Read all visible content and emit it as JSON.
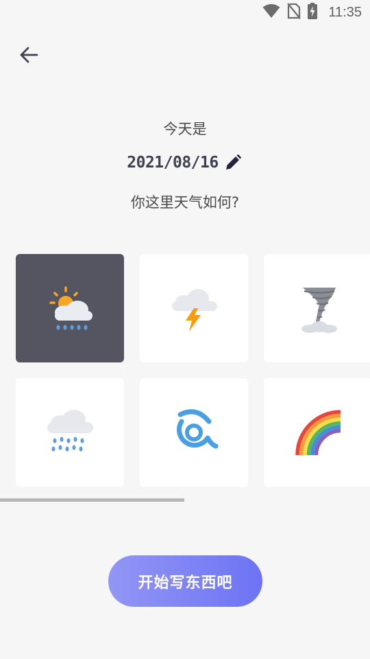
{
  "status_bar": {
    "time": "11:35",
    "icons": [
      "wifi-icon",
      "no-sim-icon",
      "battery-charging-icon"
    ]
  },
  "header": {
    "back_icon": "arrow-left-icon"
  },
  "content": {
    "today_label": "今天是",
    "date": "2021/08/16",
    "edit_icon": "pencil-icon",
    "question": "你这里天气如何?"
  },
  "weather_options": [
    {
      "icon": "sun-cloud-rain-icon",
      "selected": true
    },
    {
      "icon": "cloud-lightning-icon",
      "selected": false
    },
    {
      "icon": "tornado-icon",
      "selected": false
    },
    {
      "icon": "cloud-rain-icon",
      "selected": false
    },
    {
      "icon": "cyclone-icon",
      "selected": false
    },
    {
      "icon": "rainbow-icon",
      "selected": false
    }
  ],
  "colors": {
    "selected_tile": "#555562",
    "button_gradient_start": "#9296f5",
    "button_gradient_end": "#6d73f3"
  },
  "footer": {
    "start_button_label": "开始写东西吧"
  }
}
